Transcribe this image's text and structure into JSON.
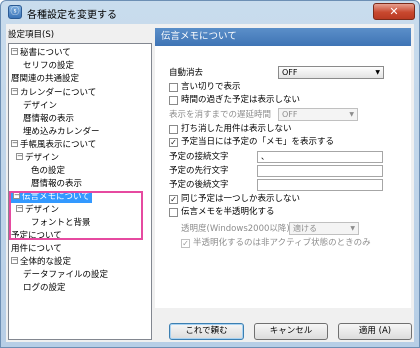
{
  "window": {
    "title": "各種設定を変更する",
    "close_glyph": "✕",
    "app_glyph": "ⓢ"
  },
  "tree": {
    "header": "設定項目(S)",
    "items": [
      {
        "label": "秘書について",
        "expander": "⊟"
      },
      {
        "label": "セリフの設定"
      },
      {
        "label": "暦関連の共通設定"
      },
      {
        "label": "カレンダーについて",
        "expander": "⊟"
      },
      {
        "label": "デザイン"
      },
      {
        "label": "暦情報の表示"
      },
      {
        "label": "埋め込みカレンダー"
      },
      {
        "label": "手帳風表示について",
        "expander": "⊟"
      },
      {
        "label": "デザイン",
        "expander": "⊟"
      },
      {
        "label": "色の設定"
      },
      {
        "label": "暦情報の表示"
      },
      {
        "label": "伝言メモについて",
        "expander": "⊟",
        "selected": true
      },
      {
        "label": "デザイン",
        "expander": "⊟"
      },
      {
        "label": "フォントと背景"
      },
      {
        "label": "予定について"
      },
      {
        "label": "用件について"
      },
      {
        "label": "全体的な設定",
        "expander": "⊟"
      },
      {
        "label": "データファイルの設定"
      },
      {
        "label": "ログの設定"
      }
    ]
  },
  "panel": {
    "header": "伝言メモについて",
    "auto_delete_label": "自動消去",
    "auto_delete_value": "OFF",
    "say_aloud_label": "言い切りで表示",
    "hide_past_label": "時間の過ぎた予定は表示しない",
    "delay_label": "表示を消すまでの遅延時間",
    "delay_value": "OFF",
    "hide_cancelled_label": "打ち消した用件は表示しない",
    "show_memo_label": "予定当日には予定の「メモ」を表示する",
    "connector_label": "予定の接続文字",
    "connector_value": "、",
    "prefix_label": "予定の先行文字",
    "prefix_value": "",
    "suffix_label": "予定の後続文字",
    "suffix_value": "",
    "same_once_label": "同じ予定は一つしか表示しない",
    "translucent_label": "伝言メモを半透明化する",
    "opacity_label": "透明度(Windows2000以降)",
    "opacity_value": "適ける",
    "inactive_only_label": "半透明化するのは非アクティブ状態のときのみ",
    "checkmark": "✓",
    "arrow": "▼"
  },
  "buttons": {
    "ok": "これで頼む",
    "cancel": "キャンセル",
    "apply": "適用 (A)"
  }
}
